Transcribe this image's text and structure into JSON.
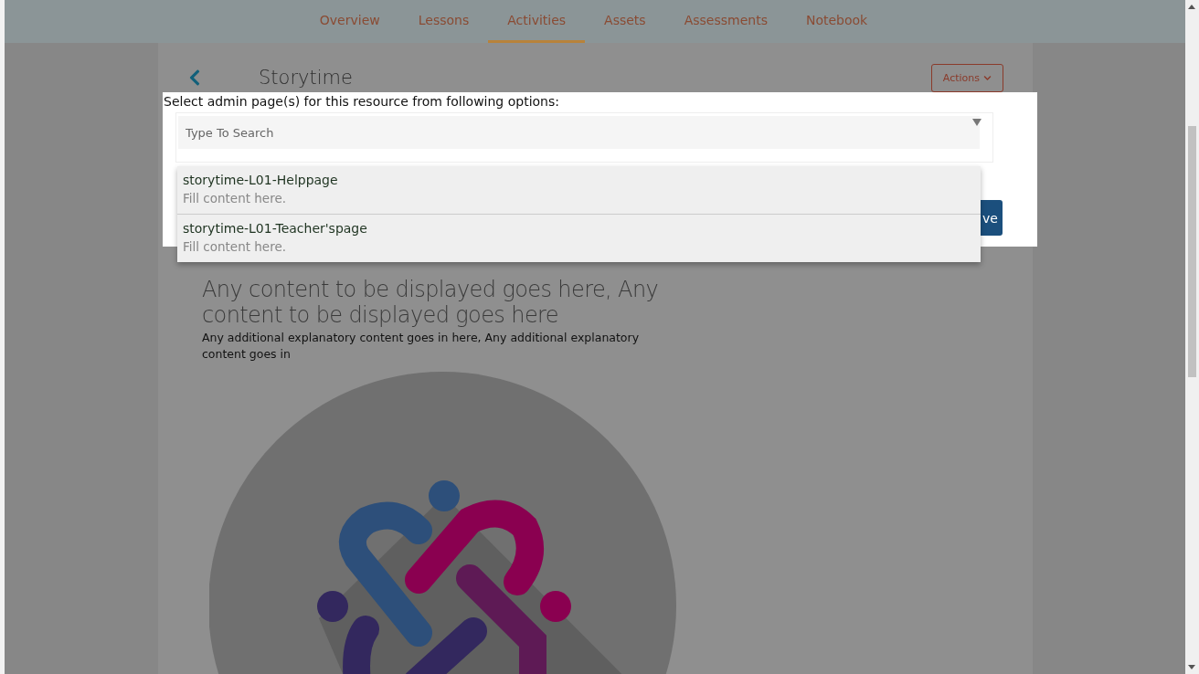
{
  "nav": {
    "tabs": [
      {
        "label": "Overview",
        "selected": false
      },
      {
        "label": "Lessons",
        "selected": false
      },
      {
        "label": "Activities",
        "selected": true
      },
      {
        "label": "Assets",
        "selected": false
      },
      {
        "label": "Assessments",
        "selected": false
      },
      {
        "label": "Notebook",
        "selected": false
      }
    ]
  },
  "page": {
    "title": "Storytime",
    "actions_button": "Actions",
    "heading": "Any content to be displayed goes here, Any content to be displayed goes here",
    "body": "Any additional explanatory content goes in here, Any additional explanatory content goes in"
  },
  "modal": {
    "label": "Select admin page(s) for this resource from following options:",
    "search": {
      "placeholder": "Type To Search"
    },
    "options": [
      {
        "title": "storytime-L01-Helppage",
        "subtitle": "Fill content here."
      },
      {
        "title": "storytime-L01-Teacher'spage",
        "subtitle": "Fill content here."
      }
    ],
    "button_visible_text": "ve"
  }
}
